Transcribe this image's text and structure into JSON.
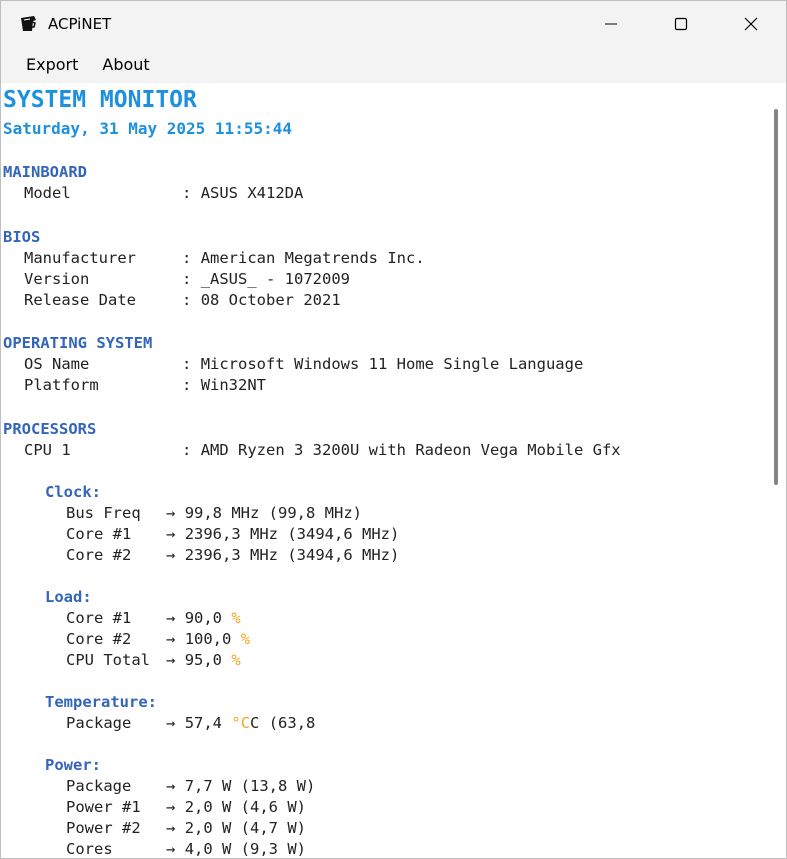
{
  "window": {
    "title": "ACPiNET",
    "icon": "cup-icon",
    "controls": [
      "minimize-icon",
      "maximize-icon",
      "close-icon"
    ]
  },
  "menu": {
    "export_label": "Export",
    "about_label": "About"
  },
  "report": {
    "title": "SYSTEM MONITOR",
    "datetime": "Saturday, 31 May 2025 11:55:44",
    "mainboard": {
      "heading": "MAINBOARD",
      "rows": [
        {
          "key": "Model",
          "sep": ":",
          "value": "ASUS X412DA"
        }
      ]
    },
    "bios": {
      "heading": "BIOS",
      "rows": [
        {
          "key": "Manufacturer",
          "sep": ":",
          "value": "American Megatrends Inc."
        },
        {
          "key": "Version",
          "sep": ":",
          "value": "_ASUS_ - 1072009"
        },
        {
          "key": "Release Date",
          "sep": ":",
          "value": "08 October 2021"
        }
      ]
    },
    "os": {
      "heading": "OPERATING SYSTEM",
      "rows": [
        {
          "key": "OS Name",
          "sep": ":",
          "value": "Microsoft Windows 11 Home Single Language"
        },
        {
          "key": "Platform",
          "sep": ":",
          "value": "Win32NT"
        }
      ]
    },
    "processors": {
      "heading": "PROCESSORS",
      "rows": [
        {
          "key": "CPU 1",
          "sep": ":",
          "value": "AMD Ryzen 3 3200U with Radeon Vega Mobile Gfx"
        }
      ],
      "clock": {
        "heading": "Clock:",
        "rows": [
          {
            "key": "Bus Freq",
            "arrow": "→",
            "value": "99,8 MHz (99,8 MHz)"
          },
          {
            "key": "Core #1",
            "arrow": "→",
            "value": "2396,3 MHz (3494,6 MHz)"
          },
          {
            "key": "Core #2",
            "arrow": "→",
            "value": "2396,3 MHz (3494,6 MHz)"
          }
        ]
      },
      "load": {
        "heading": "Load:",
        "unit": "%",
        "rows": [
          {
            "key": "Core #1",
            "arrow": "→",
            "value": "90,0"
          },
          {
            "key": "Core #2",
            "arrow": "→",
            "value": "100,0"
          },
          {
            "key": "CPU Total",
            "arrow": "→",
            "value": "95,0"
          }
        ]
      },
      "temperature": {
        "heading": "Temperature:",
        "rows": [
          {
            "key": "Package",
            "arrow": "→",
            "value": "57,4",
            "unit": "°C",
            "rest": "C (63,8"
          }
        ]
      },
      "power": {
        "heading": "Power:",
        "rows": [
          {
            "key": "Package",
            "arrow": "→",
            "value": "7,7 W (13,8 W)"
          },
          {
            "key": "Power #1",
            "arrow": "→",
            "value": "2,0 W (4,6 W)"
          },
          {
            "key": "Power #2",
            "arrow": "→",
            "value": "2,0 W (4,7 W)"
          },
          {
            "key": "Cores",
            "arrow": "→",
            "value": "4,0 W (9,3 W)"
          }
        ]
      }
    }
  },
  "colors": {
    "title": "#1e90e0",
    "section": "#3366bb",
    "unit": "#f5a623",
    "text": "#222222"
  }
}
